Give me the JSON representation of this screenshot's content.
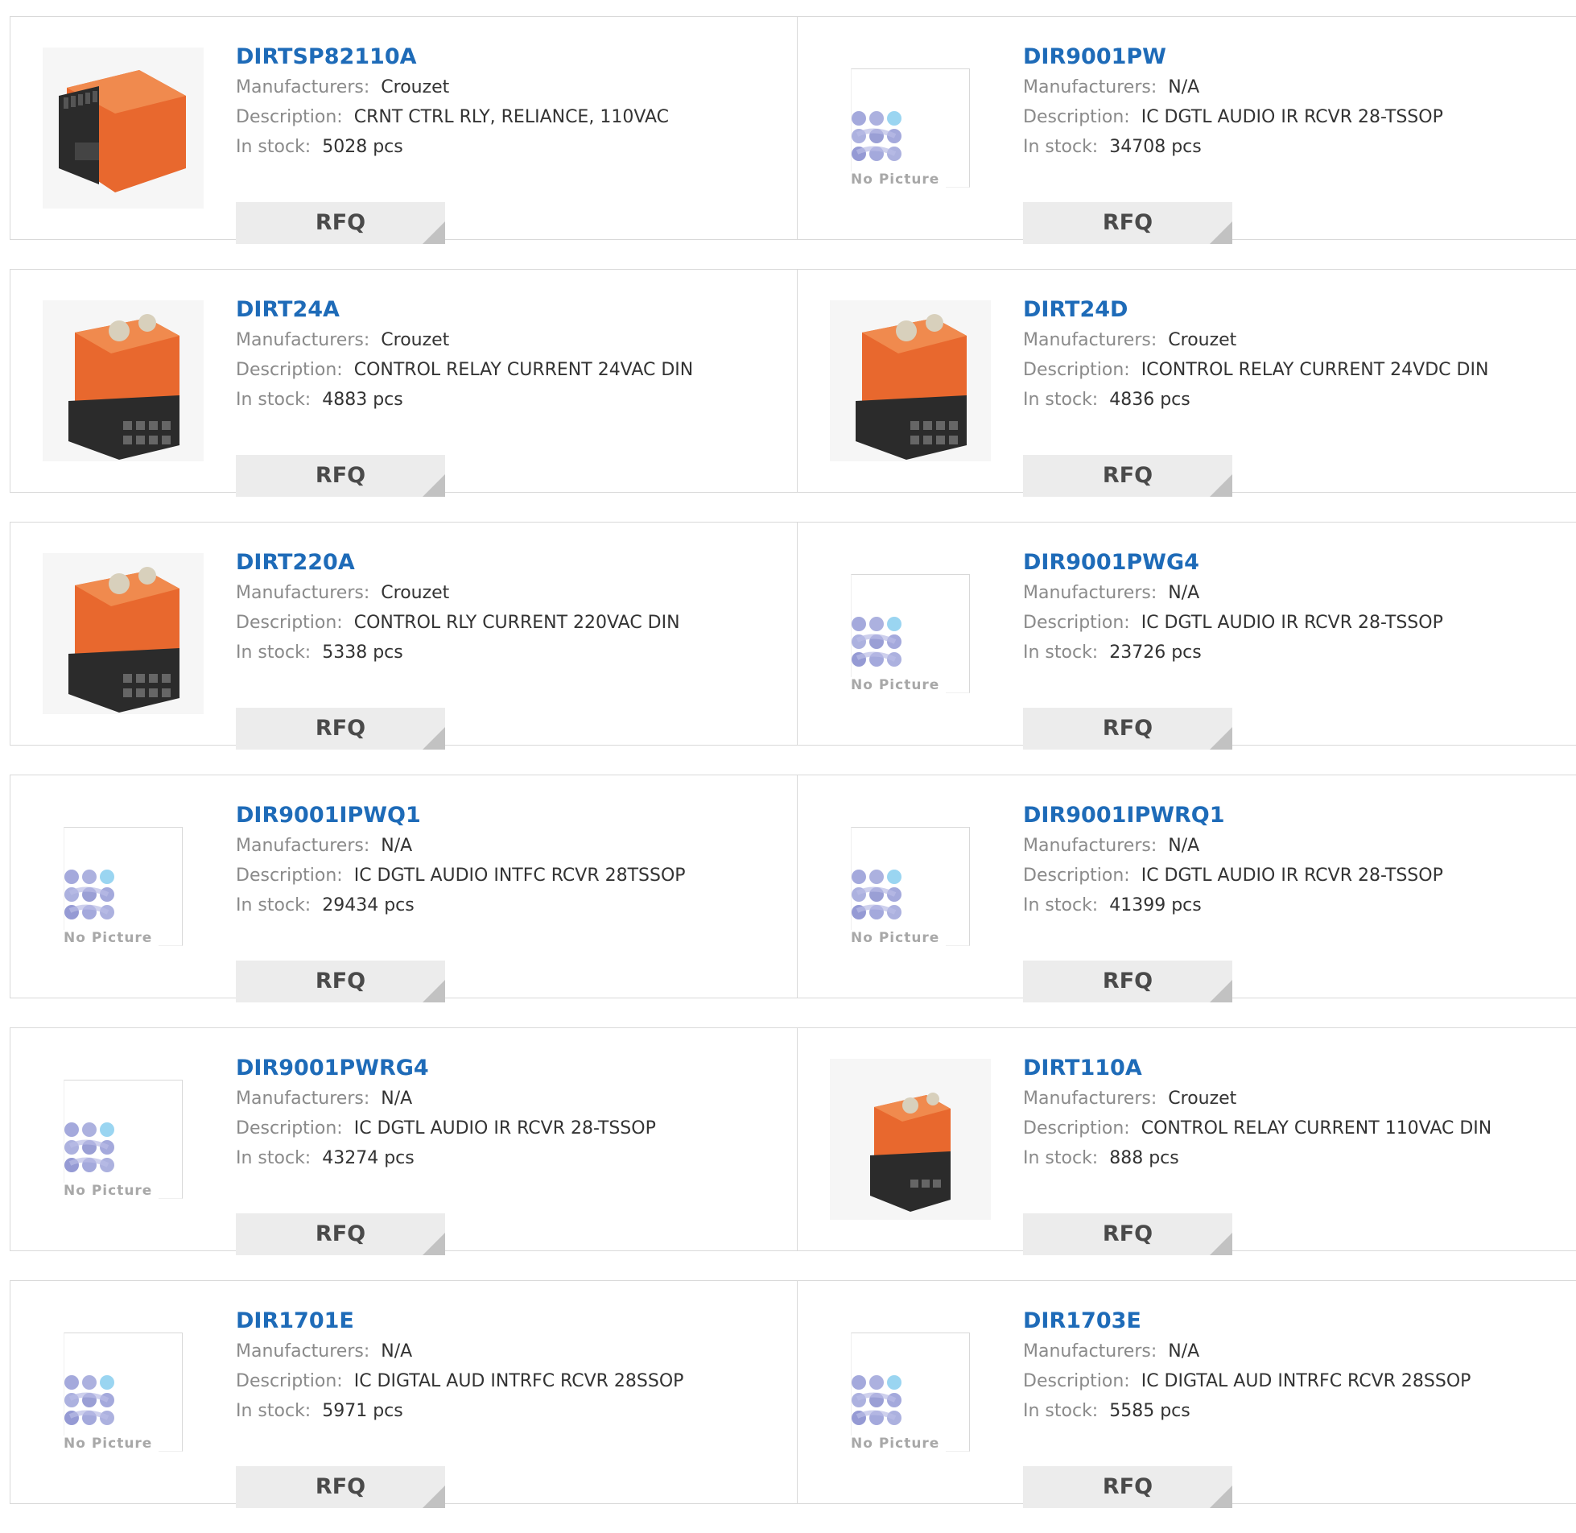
{
  "labels": {
    "manufacturer": "Manufacturers:",
    "description": "Description:",
    "stock": "In stock:",
    "rfq": "RFQ",
    "no_picture": "No Picture"
  },
  "products": [
    {
      "part": "DIRTSP82110A",
      "manufacturer": "Crouzet",
      "description": "CRNT CTRL RLY, RELIANCE, 110VAC",
      "stock": "5028 pcs",
      "image": "relay-flat"
    },
    {
      "part": "DIR9001PW",
      "manufacturer": "N/A",
      "description": "IC DGTL AUDIO IR RCVR 28-TSSOP",
      "stock": "34708 pcs",
      "image": "no-picture"
    },
    {
      "part": "DIRT24A",
      "manufacturer": "Crouzet",
      "description": "CONTROL RELAY CURRENT 24VAC DIN",
      "stock": "4883 pcs",
      "image": "relay-dial"
    },
    {
      "part": "DIRT24D",
      "manufacturer": "Crouzet",
      "description": "ICONTROL RELAY CURRENT 24VDC DIN",
      "stock": "4836 pcs",
      "image": "relay-dial"
    },
    {
      "part": "DIRT220A",
      "manufacturer": "Crouzet",
      "description": "CONTROL RLY CURRENT 220VAC DIN",
      "stock": "5338 pcs",
      "image": "relay-dial"
    },
    {
      "part": "DIR9001PWG4",
      "manufacturer": "N/A",
      "description": "IC DGTL AUDIO IR RCVR 28-TSSOP",
      "stock": "23726 pcs",
      "image": "no-picture"
    },
    {
      "part": "DIR9001IPWQ1",
      "manufacturer": "N/A",
      "description": "IC DGTL AUDIO INTFC RCVR 28TSSOP",
      "stock": "29434 pcs",
      "image": "no-picture"
    },
    {
      "part": "DIR9001IPWRQ1",
      "manufacturer": "N/A",
      "description": "IC DGTL AUDIO IR RCVR 28-TSSOP",
      "stock": "41399 pcs",
      "image": "no-picture"
    },
    {
      "part": "DIR9001PWRG4",
      "manufacturer": "N/A",
      "description": "IC DGTL AUDIO IR RCVR 28-TSSOP",
      "stock": "43274 pcs",
      "image": "no-picture"
    },
    {
      "part": "DIRT110A",
      "manufacturer": "Crouzet",
      "description": "CONTROL RELAY CURRENT 110VAC DIN",
      "stock": "888 pcs",
      "image": "relay-small"
    },
    {
      "part": "DIR1701E",
      "manufacturer": "N/A",
      "description": "IC DIGTAL AUD INTRFC RCVR 28SSOP",
      "stock": "5971 pcs",
      "image": "no-picture"
    },
    {
      "part": "DIR1703E",
      "manufacturer": "N/A",
      "description": "IC DIGTAL AUD INTRFC RCVR 28SSOP",
      "stock": "5585 pcs",
      "image": "no-picture"
    }
  ],
  "colors": {
    "link": "#1e6bb8",
    "label": "#8a8a8a",
    "value": "#333333",
    "rfq_bg": "#ececec",
    "relay_orange": "#e8682e",
    "relay_black": "#2b2b2b"
  }
}
